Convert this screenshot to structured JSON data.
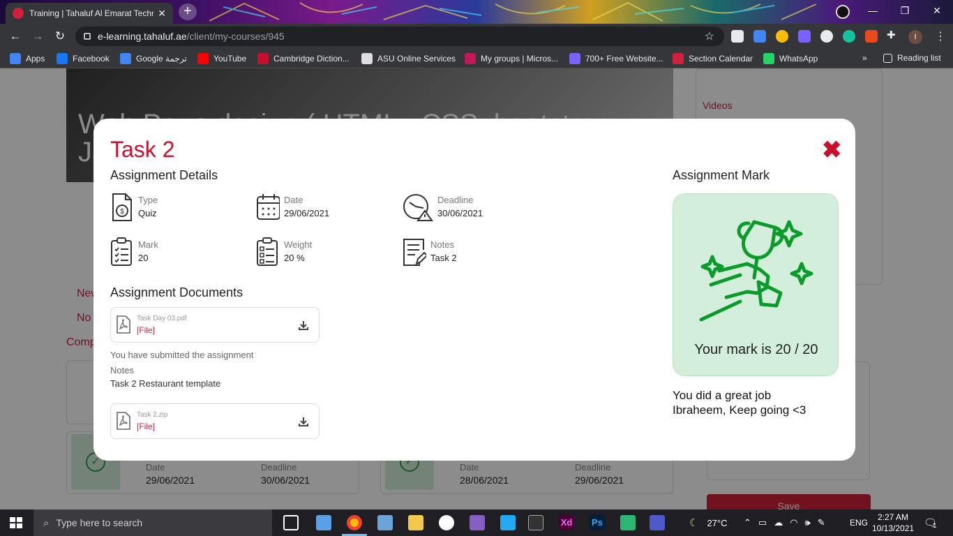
{
  "browser": {
    "tab_title": "Training | Tahaluf Al Emarat Techn",
    "tab_close": "✕",
    "new_tab": "+",
    "url_host": "e-learning.tahaluf.ae",
    "url_path": "/client/my-courses/945",
    "avatar_initial": "I",
    "window_controls": [
      "—",
      "❐",
      "✕"
    ]
  },
  "bookmarks": [
    {
      "label": "Apps",
      "icon": "apps-grid-icon",
      "color": "#4285f4"
    },
    {
      "label": "Facebook",
      "icon": "facebook-icon",
      "color": "#1877f2"
    },
    {
      "label": "Google ترجمة",
      "icon": "google-translate-icon",
      "color": "#4285f4"
    },
    {
      "label": "YouTube",
      "icon": "youtube-icon",
      "color": "#ff0000"
    },
    {
      "label": "Cambridge Diction...",
      "icon": "cambridge-icon",
      "color": "#c8102e"
    },
    {
      "label": "ASU Online Services",
      "icon": "asu-icon",
      "color": "#dddddd"
    },
    {
      "label": "My groups | Micros...",
      "icon": "microsoft-icon",
      "color": "#c2185b"
    },
    {
      "label": "700+ Free Website...",
      "icon": "colorlib-icon",
      "color": "#7b61ff"
    },
    {
      "label": "Section Calendar",
      "icon": "calendar-bookmark-icon",
      "color": "#d0213c"
    },
    {
      "label": "WhatsApp",
      "icon": "whatsapp-icon",
      "color": "#25d366"
    }
  ],
  "bookmarks_overflow": "»",
  "reading_list": "Reading list",
  "background_page": {
    "hero_title": "Web Page design ( HTML , CSS, bootstrap ,",
    "hero_title_line2": "Ja",
    "videos_label": "Videos",
    "new_label": "New",
    "not_label": "No",
    "comp_label": "Comp",
    "card1": {
      "date_label": "Date",
      "date": "29/06/2021",
      "deadline_label": "Deadline",
      "deadline": "30/06/2021"
    },
    "card2": {
      "date_label": "Date",
      "date": "28/06/2021",
      "deadline_label": "Deadline",
      "deadline": "29/06/2021"
    },
    "save_label": "Save"
  },
  "modal": {
    "title": "Task 2",
    "close": "✖",
    "details_heading": "Assignment Details",
    "details": [
      {
        "label": "Type",
        "value": "Quiz",
        "icon": "document-type-icon"
      },
      {
        "label": "Date",
        "value": "29/06/2021",
        "icon": "calendar-icon"
      },
      {
        "label": "Deadline",
        "value": "30/06/2021",
        "icon": "deadline-clock-icon"
      },
      {
        "label": "Mark",
        "value": "20",
        "icon": "clipboard-check-icon"
      },
      {
        "label": "Weight",
        "value": "20 %",
        "icon": "weight-list-icon"
      },
      {
        "label": "Notes",
        "value": "Task 2",
        "icon": "notes-edit-icon"
      }
    ],
    "documents_heading": "Assignment Documents",
    "documents": [
      {
        "name": "Task Day 03.pdf",
        "type": "[File]"
      },
      {
        "name": "Task 2.zip",
        "type": "[File]"
      }
    ],
    "submitted_text": "You have submitted the assignment",
    "notes_label": "Notes",
    "notes_value": "Task 2 Restaurant template",
    "mark_heading": "Assignment Mark",
    "mark_text": "Your mark is 20 / 20",
    "mark_message_line1": "You did a great job",
    "mark_message_line2": "Ibraheem, Keep going <3",
    "mark_color": "#0a9b2a"
  },
  "taskbar": {
    "search_placeholder": "Type here to search",
    "temperature": "27°C",
    "language": "ENG",
    "time": "2:27 AM",
    "date": "10/13/2021",
    "notification_count": "1"
  }
}
